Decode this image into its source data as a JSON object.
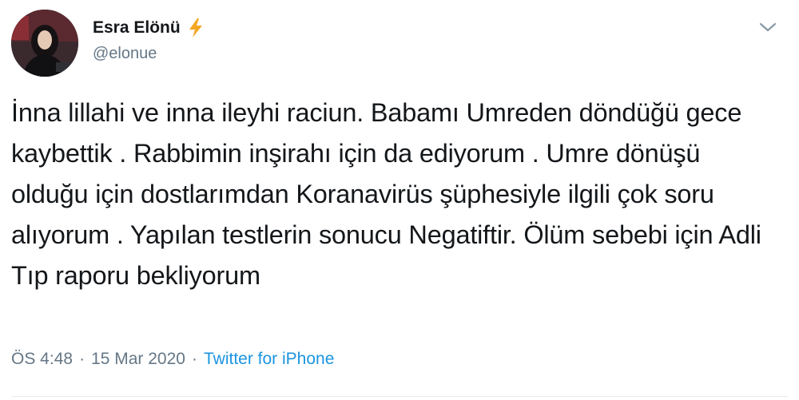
{
  "user": {
    "display_name": "Esra Elönü",
    "handle": "@elonue",
    "badge_icon": "lightning-bolt-icon",
    "badge_color": "#f5a623",
    "avatar_icon": "profile-photo-avatar"
  },
  "tweet": {
    "text": "İnna lillahi ve inna ileyhi raciun. Babamı Umreden döndüğü gece kaybettik . Rabbimin inşirahı için da ediyorum . Umre dönüşü olduğu için dostlarımdan Koranavirüs şüphesiyle ilgili çok soru alıyorum . Yapılan testlerin sonucu Negatiftir. Ölüm sebebi için Adli Tıp raporu bekliyorum",
    "time": "ÖS 4:48",
    "separator": "·",
    "date": "15 Mar 2020",
    "source": "Twitter for iPhone"
  },
  "menu": {
    "icon": "chevron-down-icon"
  },
  "colors": {
    "text": "#14171a",
    "secondary": "#657786",
    "link": "#1b95e0"
  }
}
